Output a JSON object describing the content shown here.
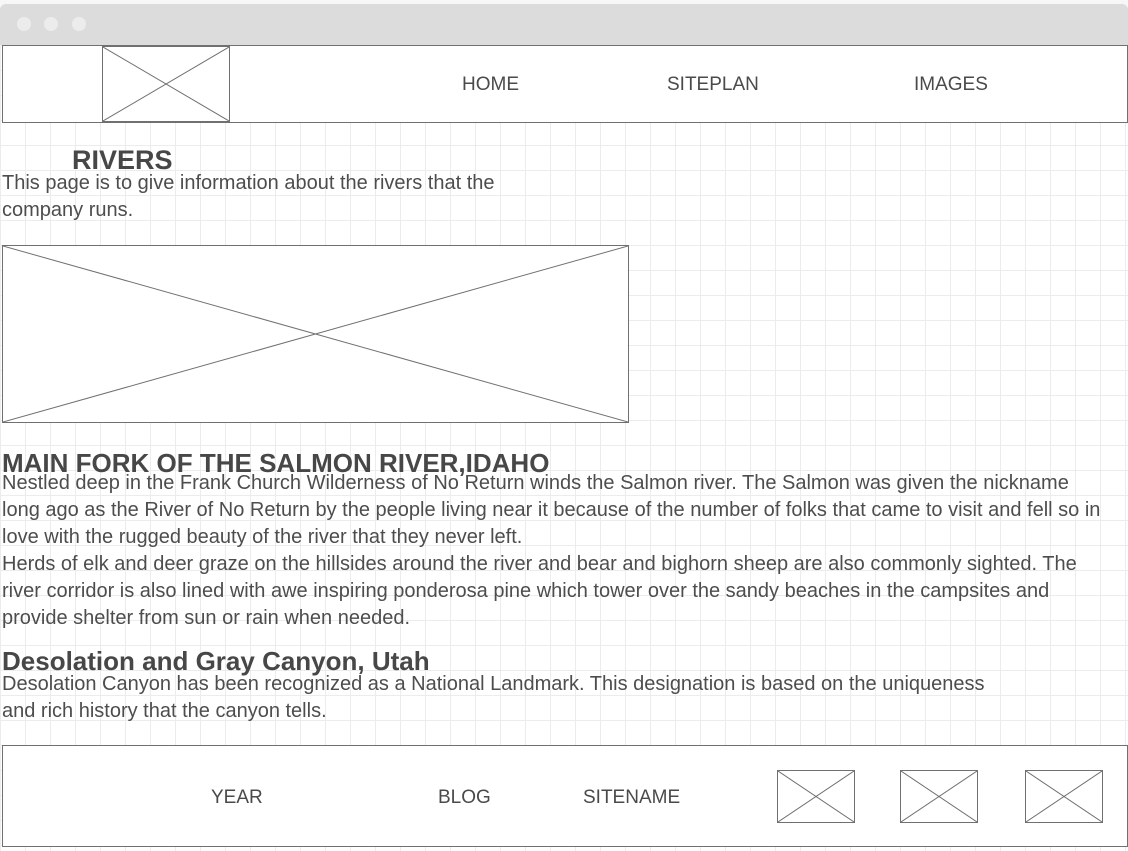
{
  "header": {
    "nav": [
      {
        "label": "HOME"
      },
      {
        "label": "SITEPLAN"
      },
      {
        "label": "IMAGES"
      }
    ]
  },
  "intro": {
    "title": "RIVERS",
    "text": "This page is to give information about the rivers that the company runs."
  },
  "sections": [
    {
      "title": "MAIN FORK OF THE SALMON RIVER,IDAHO",
      "paragraphs": [
        "Nestled deep in the Frank Church Wilderness of No Return winds the Salmon river. The Salmon was given the nickname long ago as the River of No Return by the people living near it because of the number of folks that came to visit and fell so in love with the rugged beauty of the river that they never left.",
        "Herds of elk and deer graze on the hillsides around the river and bear and bighorn sheep are also commonly sighted. The river corridor is also lined with awe inspiring ponderosa pine which tower over the sandy beaches in the campsites and provide shelter from sun or rain when needed."
      ]
    },
    {
      "title": "Desolation and Gray Canyon, Utah",
      "paragraphs": [
        "Desolation Canyon has been recognized as a National Landmark. This designation is based on the uniqueness and rich history that the canyon tells."
      ]
    }
  ],
  "footer": {
    "links": [
      {
        "label": "YEAR"
      },
      {
        "label": "BLOG"
      },
      {
        "label": "SITENAME"
      }
    ]
  },
  "icons": {
    "window_controls": [
      "close-dot",
      "minimize-dot",
      "maximize-dot"
    ],
    "placeholder": "image-placeholder-icon"
  },
  "colors": {
    "border": "#707070",
    "text": "#4a4a4a",
    "titlebar": "#dcdcdc",
    "grid": "#ececec"
  }
}
